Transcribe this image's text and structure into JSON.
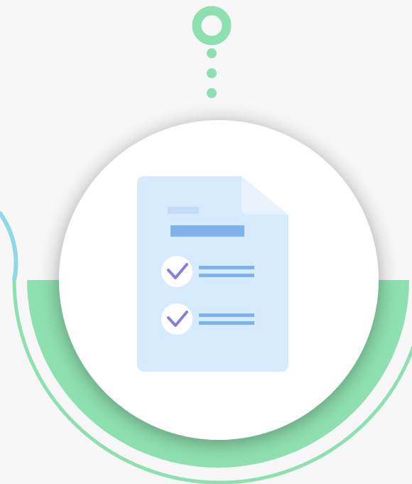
{
  "illustration": {
    "subject": "document-checklist",
    "checklist_items": 2,
    "icons": [
      "ring-icon",
      "dot-icon",
      "document-icon",
      "check-icon"
    ]
  },
  "colors": {
    "background": "#f7f7f7",
    "green": "#8fe0b0",
    "teal_arc": "#8fd9e6",
    "circle": "#ffffff",
    "document": "#d6ebfd",
    "document_fold": "#e9f3fe",
    "document_line": "#7fb1ea",
    "document_line_light": "#c3dcf8",
    "check": "#8680dc"
  }
}
